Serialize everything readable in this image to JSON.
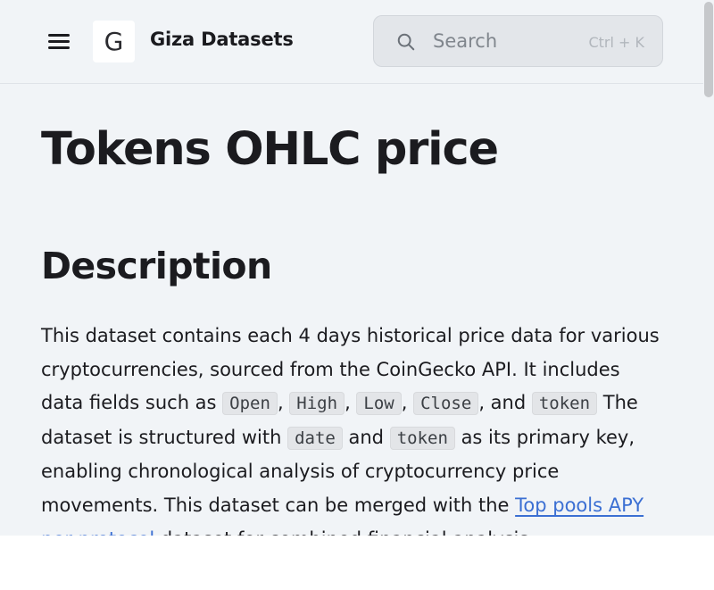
{
  "header": {
    "logo_letter": "G",
    "site_title": "Giza Datasets",
    "search": {
      "placeholder": "Search",
      "shortcut": "Ctrl + K"
    }
  },
  "page": {
    "title": "Tokens OHLC price",
    "section_heading": "Description",
    "paragraph": {
      "t1": "This dataset contains each 4 days historical price data for various cryptocurrencies, sourced from the CoinGecko API. It includes data fields such as ",
      "code_open": "Open",
      "sep1": ", ",
      "code_high": "High",
      "sep2": ", ",
      "code_low": "Low",
      "sep3": ", ",
      "code_close": "Close",
      "t2": ", and ",
      "code_token": "token",
      "t3": " The dataset is structured with ",
      "code_date": "date",
      "t4": " and ",
      "code_token2": "token",
      "t5": " as its primary key, enabling chronological analysis of cryptocurrency price movements. This dataset can be merged with the ",
      "link_text": "Top pools APY per protocol",
      "t6": " dataset for combined financial analysis"
    }
  },
  "colors": {
    "background": "#f1f4f7",
    "text": "#1b1b1f",
    "link": "#3b6fd3",
    "code_bg": "#e3e5e8"
  }
}
